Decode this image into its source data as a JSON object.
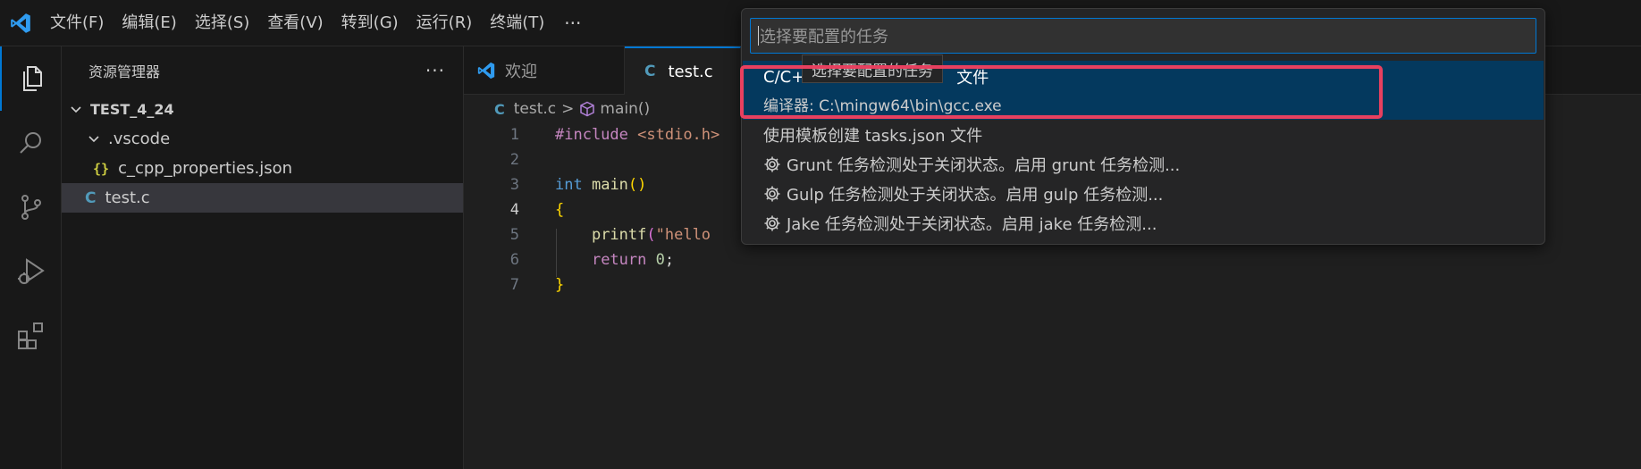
{
  "menu": {
    "items": [
      "文件(F)",
      "编辑(E)",
      "选择(S)",
      "查看(V)",
      "转到(G)",
      "运行(R)",
      "终端(T)"
    ],
    "more": "···"
  },
  "sidebar": {
    "title": "资源管理器",
    "more": "···",
    "root": "TEST_4_24",
    "folder": ".vscode",
    "json_icon": "{}",
    "json_file": "c_cpp_properties.json",
    "c_icon": "C",
    "c_file": "test.c"
  },
  "tabs": {
    "welcome": "欢迎",
    "active": "test.c",
    "c_icon": "C"
  },
  "breadcrumb": {
    "file": "test.c",
    "sep": ">",
    "symbol": "main()"
  },
  "code": {
    "line_numbers": [
      "1",
      "2",
      "3",
      "4",
      "5",
      "6",
      "7"
    ],
    "l1_kw": "#include",
    "l1_inc": "<stdio.h>",
    "l3_type": "int",
    "l3_fn": "main",
    "l3_paren": "()",
    "l4_brace": "{",
    "l5_fn": "printf",
    "l5_paren": "(",
    "l5_str": "\"hello",
    "l6_kw": "return",
    "l6_num": "0",
    "l6_semi": ";",
    "l7_brace": "}"
  },
  "quickpick": {
    "placeholder": "选择要配置的任务",
    "selected_label_prefix": "C/C+",
    "selected_label_suffix": "文件",
    "selected_detail": "编译器: C:\\mingw64\\bin\\gcc.exe",
    "tooltip": "选择要配置的任务",
    "items": [
      "使用模板创建 tasks.json 文件",
      "Grunt 任务检测处于关闭状态。启用 grunt 任务检测...",
      "Gulp 任务检测处于关闭状态。启用 gulp 任务检测...",
      "Jake 任务检测处于关闭状态。启用 jake 任务检测..."
    ]
  },
  "colors": {
    "accent": "#0078d4",
    "highlight_box": "#e8405f",
    "selection": "#04395e"
  }
}
